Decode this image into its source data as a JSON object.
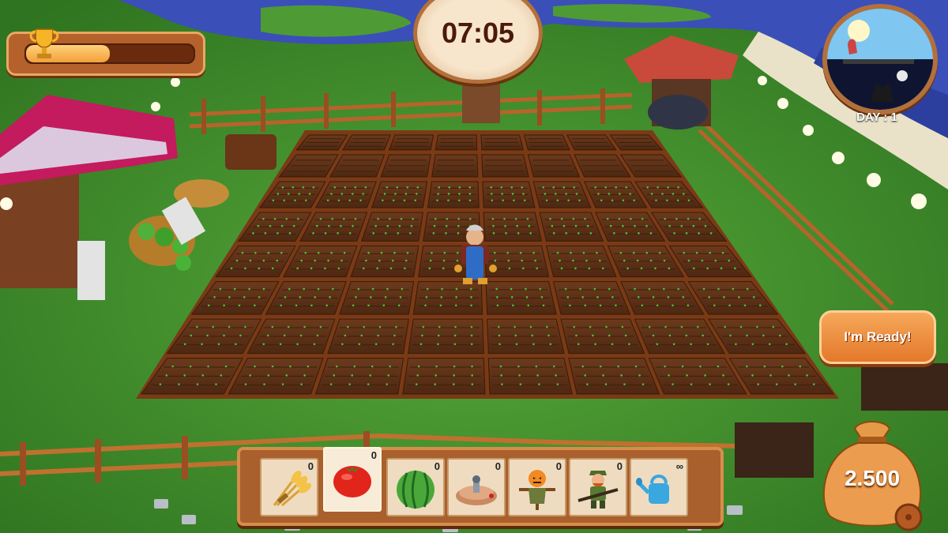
{
  "hud": {
    "progress": {
      "fraction": 0.5
    },
    "timer": "07:05",
    "day_label": "DAY : 1",
    "ready_button": "I'm Ready!",
    "money": "2.500"
  },
  "hotbar": {
    "slots": [
      {
        "icon": "wheat-icon",
        "count": "0",
        "selected": false
      },
      {
        "icon": "tomato-icon",
        "count": "0",
        "selected": true
      },
      {
        "icon": "watermelon-icon",
        "count": "0",
        "selected": false
      },
      {
        "icon": "sprinkler-icon",
        "count": "0",
        "selected": false
      },
      {
        "icon": "scarecrow-icon",
        "count": "0",
        "selected": false
      },
      {
        "icon": "hunter-icon",
        "count": "0",
        "selected": false
      },
      {
        "icon": "watering-can-icon",
        "count": "∞",
        "selected": false
      }
    ]
  },
  "colors": {
    "grass": "#3c8a2a",
    "soil": "#5a2e16",
    "water": "#3b4fb8",
    "ui_wood": "#a9602c",
    "ui_accent": "#f2a03a"
  }
}
